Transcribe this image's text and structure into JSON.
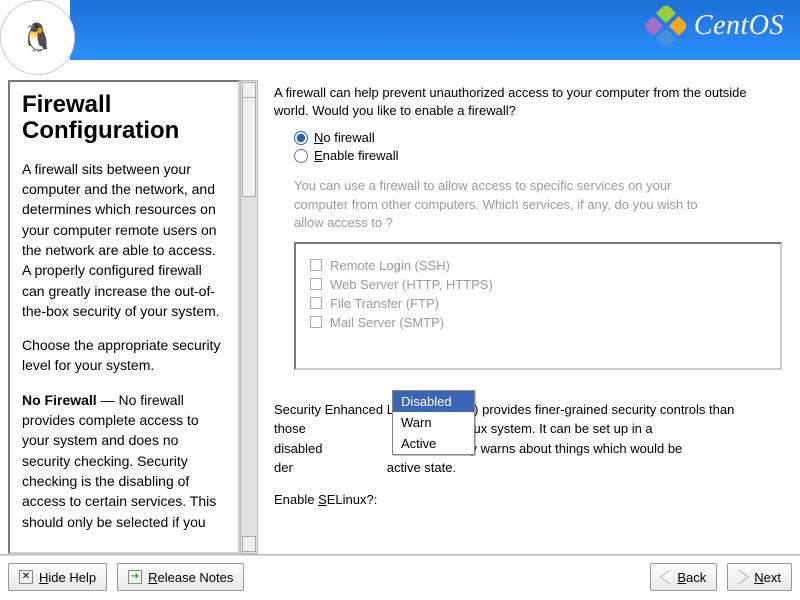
{
  "brand": "CentOS",
  "help": {
    "title": "Firewall Configuration",
    "para1": "A firewall sits between your computer and the network, and determines which resources on your computer remote users on the network are able to access. A properly configured firewall can greatly increase the out-of-the-box security of your system.",
    "para2": "Choose the appropriate security level for your system.",
    "para3_label": "No Firewall",
    "para3_rest": " — No firewall provides complete access to your system and does no security checking. Security checking is the disabling of access to certain services. This should only be selected if you"
  },
  "main": {
    "intro": "A firewall can help prevent unauthorized access to your computer from the outside world.  Would you like to enable a firewall?",
    "radio_no_prefix": "N",
    "radio_no_rest": "o firewall",
    "radio_enable_prefix": "E",
    "radio_enable_rest": "nable firewall",
    "services_intro": "You can use a firewall to allow access to specific services on your computer from other computers. Which services, if any, do you wish to allow access to ?",
    "services": {
      "ssh": "Remote Login (SSH)",
      "http": "Web Server (HTTP, HTTPS)",
      "ftp": "File Transfer (FTP)",
      "smtp": "Mail Server (SMTP)"
    },
    "selinux_text_1": "Security Enhanced Linux (SELinux) provides finer-grained security controls than those",
    "selinux_text_2": "raditional Linux system.  It can be set up in a disabled",
    "selinux_text_3": "which only warns about things which would be der",
    "selinux_text_4": "active state.",
    "selinux_label_pre": "Enable ",
    "selinux_label_u": "S",
    "selinux_label_post": "ELinux?:"
  },
  "dropdown": {
    "disabled": "Disabled",
    "warn": "Warn",
    "active": "Active"
  },
  "footer": {
    "hide_help_u": "H",
    "hide_help_rest": "ide Help",
    "release_u": "R",
    "release_rest": "elease Notes",
    "back_u": "B",
    "back_rest": "ack",
    "next_u": "N",
    "next_rest": "ext"
  }
}
